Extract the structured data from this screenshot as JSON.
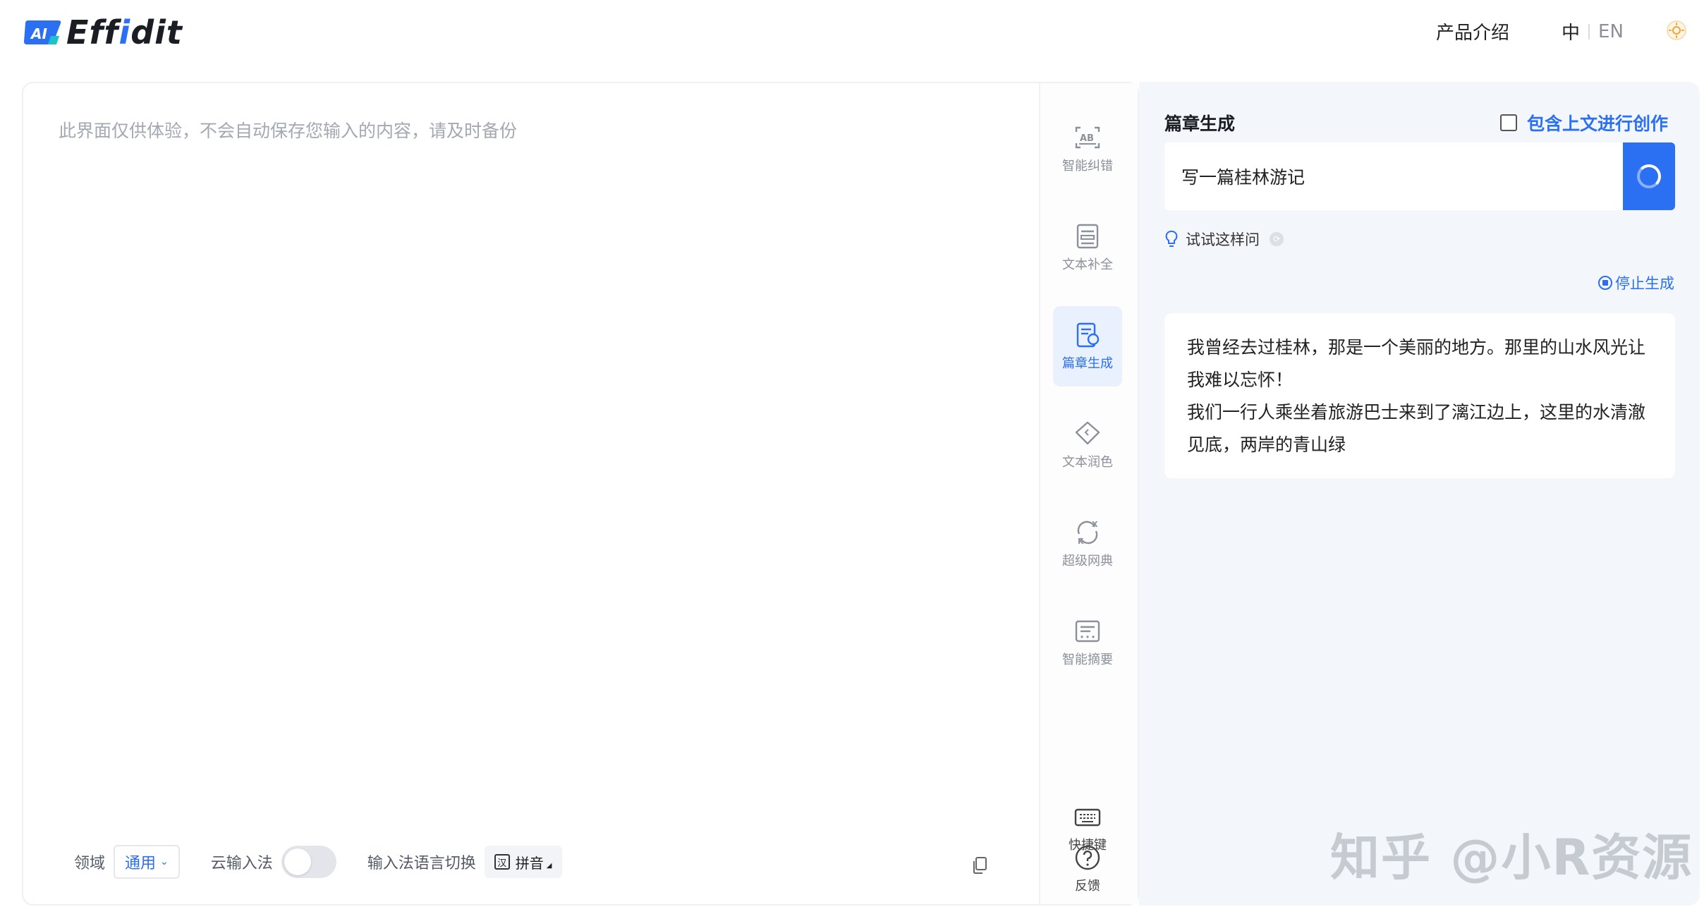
{
  "header": {
    "logo_text_prefix": "Eff",
    "logo_text_highlight": "i",
    "logo_text_suffix": "dit",
    "logo_badge": "AI",
    "nav_product": "产品介绍",
    "lang_zh": "中",
    "lang_en": "EN"
  },
  "editor": {
    "placeholder": "此界面仅供体验，不会自动保存您输入的内容，请及时备份",
    "domain_label": "领域",
    "domain_value": "通用",
    "cloud_ime_label": "云输入法",
    "ime_switch_label": "输入法语言切换",
    "ime_value": "拼音",
    "ime_icon_char": "汉"
  },
  "tools": [
    {
      "label": "智能纠错",
      "icon": "ab-correction-icon"
    },
    {
      "label": "文本补全",
      "icon": "text-completion-icon"
    },
    {
      "label": "篇章生成",
      "icon": "article-generation-icon"
    },
    {
      "label": "文本润色",
      "icon": "text-polish-icon"
    },
    {
      "label": "超级网典",
      "icon": "super-dictionary-icon"
    },
    {
      "label": "智能摘要",
      "icon": "smart-summary-icon"
    },
    {
      "label": "快捷键",
      "icon": "keyboard-icon"
    },
    {
      "label": "反馈",
      "icon": "feedback-icon"
    }
  ],
  "panel": {
    "title": "篇章生成",
    "context_option": "包含上文进行创作",
    "prompt_value": "写一篇桂林游记",
    "try_label": "试试这样问",
    "stop_label": "停止生成",
    "result_paragraphs": [
      "我曾经去过桂林，那是一个美丽的地方。那里的山水风光让我难以忘怀！",
      "我们一行人乘坐着旅游巴士来到了漓江边上，这里的水清澈见底，两岸的青山绿"
    ]
  },
  "watermark": "知乎 @小R资源",
  "colors": {
    "accent": "#2b6ff3",
    "panel_bg": "#f3f6fa",
    "active_tool_bg": "#e8f1fd"
  }
}
